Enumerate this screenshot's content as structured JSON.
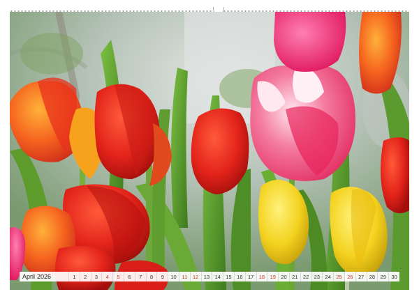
{
  "calendar": {
    "month": "April",
    "year": "2026",
    "days": [
      {
        "n": "1",
        "weekend": false
      },
      {
        "n": "2",
        "weekend": false
      },
      {
        "n": "3",
        "weekend": false
      },
      {
        "n": "4",
        "weekend": true
      },
      {
        "n": "5",
        "weekend": true
      },
      {
        "n": "6",
        "weekend": false
      },
      {
        "n": "7",
        "weekend": false
      },
      {
        "n": "8",
        "weekend": false
      },
      {
        "n": "9",
        "weekend": false
      },
      {
        "n": "10",
        "weekend": false
      },
      {
        "n": "11",
        "weekend": true
      },
      {
        "n": "12",
        "weekend": true
      },
      {
        "n": "13",
        "weekend": false
      },
      {
        "n": "14",
        "weekend": false
      },
      {
        "n": "15",
        "weekend": false
      },
      {
        "n": "16",
        "weekend": false
      },
      {
        "n": "17",
        "weekend": false
      },
      {
        "n": "18",
        "weekend": true
      },
      {
        "n": "19",
        "weekend": true
      },
      {
        "n": "20",
        "weekend": false
      },
      {
        "n": "21",
        "weekend": false
      },
      {
        "n": "22",
        "weekend": false
      },
      {
        "n": "23",
        "weekend": false
      },
      {
        "n": "24",
        "weekend": false
      },
      {
        "n": "25",
        "weekend": true
      },
      {
        "n": "26",
        "weekend": true
      },
      {
        "n": "27",
        "weekend": false
      },
      {
        "n": "28",
        "weekend": false
      },
      {
        "n": "29",
        "weekend": false
      },
      {
        "n": "30",
        "weekend": false
      }
    ]
  },
  "colors": {
    "red_tulip": "#e2231a",
    "orange_tulip": "#f57c1f",
    "pink_tulip": "#f0457a",
    "yellow_tulip": "#f3d21f",
    "leaf_green": "#5b9a2e",
    "weekend_text": "#c0392b"
  }
}
